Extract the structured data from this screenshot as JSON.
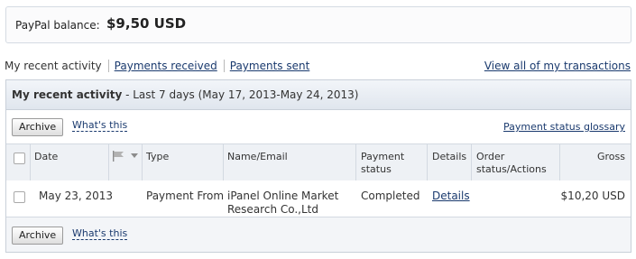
{
  "balance": {
    "label": "PayPal balance:",
    "value": "$9,50 USD"
  },
  "tabs": {
    "active": "My recent activity",
    "payments_received": "Payments received",
    "payments_sent": "Payments sent"
  },
  "view_all_link": "View all of my transactions",
  "panel": {
    "title_bold": "My recent activity",
    "title_rest": " - Last 7 days (May 17, 2013-May 24, 2013)"
  },
  "toolbar": {
    "archive_label": "Archive",
    "whats_this_label": "What's this",
    "glossary_link": "Payment status glossary"
  },
  "table": {
    "headers": {
      "date": "Date",
      "type": "Type",
      "name_email": "Name/Email",
      "payment_status": "Payment status",
      "details": "Details",
      "order_status": "Order status/Actions",
      "gross": "Gross"
    },
    "rows": [
      {
        "date": "May 23, 2013",
        "type": "Payment From",
        "name": "iPanel Online Market Research Co.,Ltd",
        "status": "Completed",
        "details": "Details",
        "order_status": "",
        "gross": "$10,20 USD"
      }
    ]
  },
  "footer": {
    "archive_label": "Archive",
    "whats_this_label": "What's this"
  },
  "icons": {
    "flag": "flag-icon",
    "dropdown": "chevron-down-icon"
  },
  "colors": {
    "link": "#1a3a6e",
    "header_bg": "#e0e6ee",
    "border": "#c9d0d9"
  }
}
